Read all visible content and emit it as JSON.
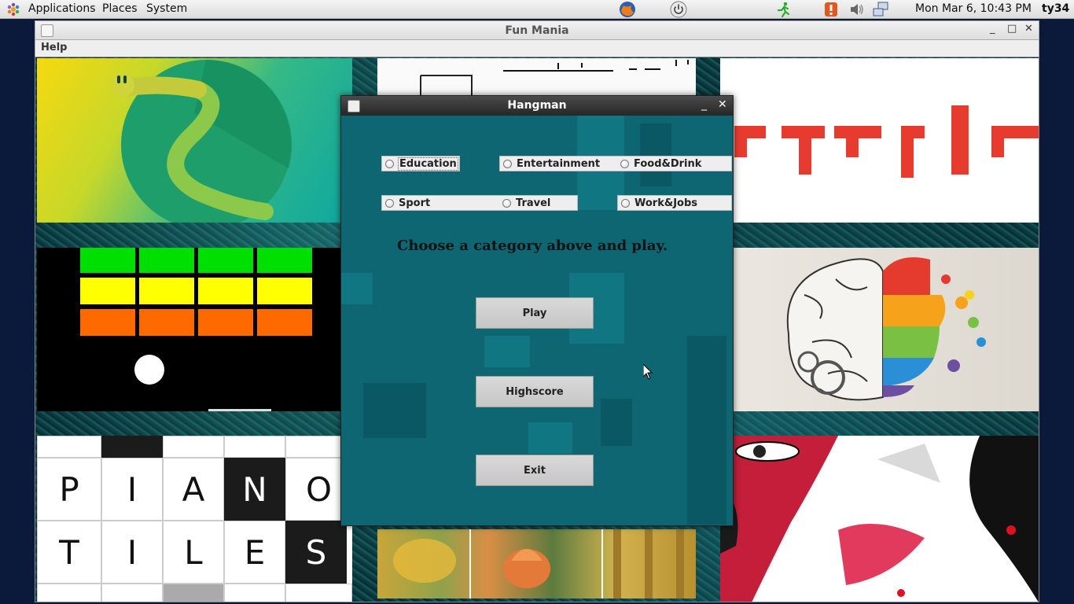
{
  "panel": {
    "menus": [
      "Applications",
      "Places",
      "System"
    ],
    "clock": "Mon Mar  6, 10:43 PM",
    "user": "ty34",
    "icons": [
      "gnome-foot-icon",
      "firefox-icon",
      "power-icon",
      "running-man-icon",
      "alert-icon",
      "volume-icon",
      "network-icon"
    ]
  },
  "main_window": {
    "title": "Fun Mania",
    "menu": [
      "Help"
    ],
    "controls": {
      "minimize": "_",
      "maximize": "□",
      "close": "✕"
    },
    "tiles": [
      "snake",
      "sketch",
      "tetris",
      "breakout",
      "brain",
      "piano-tiles",
      "lotus-painting",
      "anime"
    ]
  },
  "piano_tiles": {
    "letters_row1": [
      "P",
      "I",
      "A",
      "N",
      "O"
    ],
    "letters_row2": [
      "T",
      "I",
      "L",
      "E",
      "S"
    ]
  },
  "hangman": {
    "title": "Hangman",
    "controls": {
      "minimize": "_",
      "close": "✕"
    },
    "categories": [
      "Education",
      "Entertainment",
      "Food&Drink",
      "Sport",
      "Travel",
      "Work&Jobs"
    ],
    "message": "Choose a category above and play.",
    "buttons": {
      "play": "Play",
      "highscore": "Highscore",
      "exit": "Exit"
    }
  },
  "colors": {
    "dialog_bg": "#0f6c78",
    "tetris_red": "#e63b2e",
    "breakout_green": "#00e000",
    "breakout_yellow": "#ffff00",
    "breakout_orange": "#ff6a00"
  }
}
